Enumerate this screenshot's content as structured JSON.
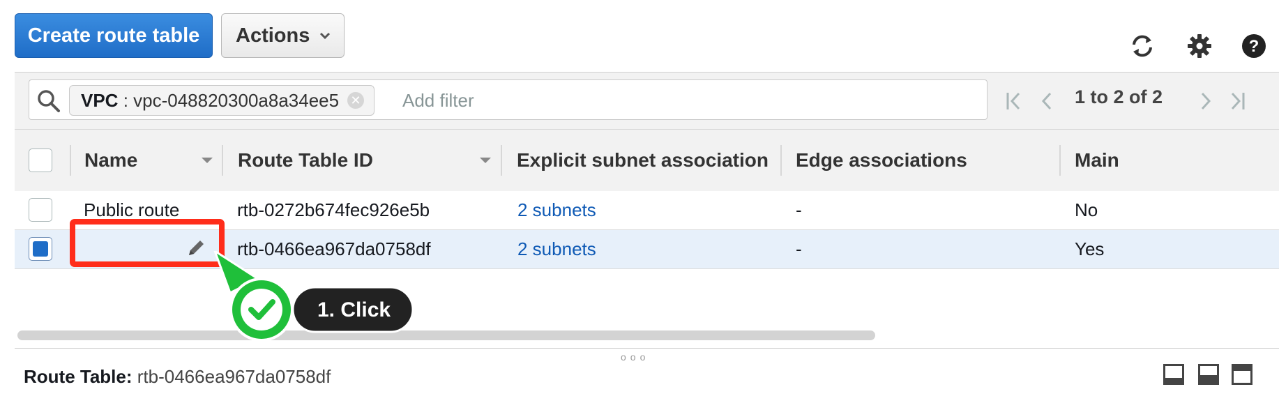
{
  "toolbar": {
    "create_label": "Create route table",
    "actions_label": "Actions"
  },
  "filter": {
    "token_key": "VPC",
    "token_sep": " : ",
    "token_value": "vpc-048820300a8a34ee5",
    "placeholder": "Add filter"
  },
  "pagination": {
    "text": "1 to 2 of 2"
  },
  "table": {
    "headers": [
      "Name",
      "Route Table ID",
      "Explicit subnet association",
      "Edge associations",
      "Main"
    ],
    "rows": [
      {
        "name": "Public route",
        "id": "rtb-0272b674fec926e5b",
        "subnets": "2 subnets",
        "edge": "-",
        "main": "No",
        "selected": false
      },
      {
        "name": "",
        "id": "rtb-0466ea967da0758df",
        "subnets": "2 subnets",
        "edge": "-",
        "main": "Yes",
        "selected": true
      }
    ]
  },
  "annotation": {
    "step_label": "1. Click",
    "color_highlight": "#ff2d1a",
    "color_callout": "#1fbf3a"
  },
  "footer": {
    "label": "Route Table:",
    "value": "rtb-0466ea967da0758df"
  },
  "icons": [
    "refresh-icon",
    "settings-icon",
    "help-icon",
    "search-icon",
    "pencil-icon"
  ]
}
